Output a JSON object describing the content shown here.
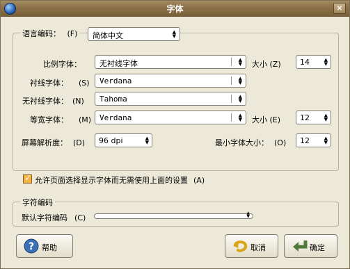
{
  "window": {
    "title": "字体"
  },
  "language": {
    "label": "语言编码：",
    "shortcut": "(F)",
    "value": "简体中文"
  },
  "fonts": {
    "proportional": {
      "label": "比例字体：",
      "value": "无衬线字体"
    },
    "size_label": "大小",
    "size_shortcut": "(Z)",
    "size_value": "14",
    "serif": {
      "label": "衬线字体：",
      "shortcut": "(S)",
      "value": "Verdana"
    },
    "sans_serif": {
      "label": "无衬线字体：",
      "shortcut": "(N)",
      "value": "Tahoma"
    },
    "monospace": {
      "label": "等宽字体：",
      "shortcut": "(M)",
      "value": "Verdana"
    },
    "mono_size_label": "大小",
    "mono_size_shortcut": "(E)",
    "mono_size_value": "12",
    "resolution": {
      "label": "屏幕解析度：",
      "shortcut": "(D)",
      "value": "96 dpi"
    },
    "min_size": {
      "label": "最小字体大小：",
      "shortcut": "(O)",
      "value": "12"
    },
    "allow_page_fonts": {
      "label": "允许页面选择显示字体而无需使用上面的设置",
      "shortcut": "(A)",
      "checked": true
    }
  },
  "encoding": {
    "group_title": "字符编码",
    "default_label": "默认字符编码",
    "default_shortcut": "(C)",
    "default_value": ""
  },
  "buttons": {
    "help": "帮助",
    "cancel": "取消",
    "ok": "确定"
  },
  "colors": {
    "titlebar": "#8c7148",
    "background": "#ECE9D8",
    "checkbox": "#f7b347"
  }
}
